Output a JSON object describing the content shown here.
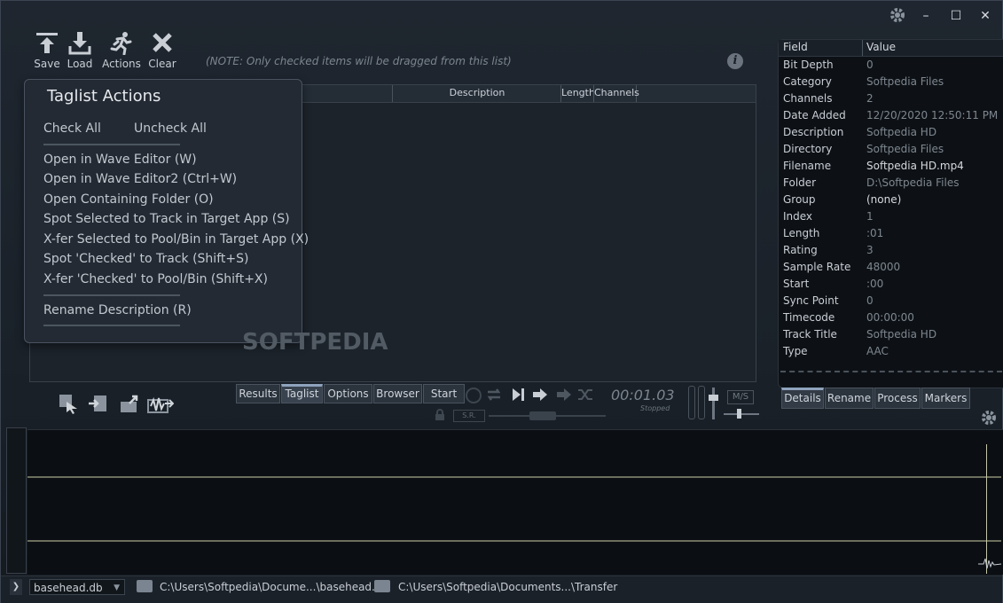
{
  "window": {
    "settings_icon": "gear-icon",
    "minimize": "–",
    "maximize": "☐",
    "close": "✕"
  },
  "toolbar": {
    "save": "Save",
    "load": "Load",
    "actions": "Actions",
    "clear": "Clear",
    "note": "(NOTE: Only checked items will be dragged from this list)"
  },
  "list": {
    "columns": [
      "Description",
      "Length",
      "Channels"
    ]
  },
  "menu": {
    "title": "Taglist Actions",
    "check_all": "Check All",
    "uncheck_all": "Uncheck All",
    "items": [
      "Open in Wave Editor (W)",
      "Open in Wave Editor2 (Ctrl+W)",
      "Open Containing Folder (O)",
      "Spot Selected to Track in Target App (S)",
      "X-fer Selected to Pool/Bin in Target App (X)",
      "Spot 'Checked' to Track (Shift+S)",
      "X-fer 'Checked' to Pool/Bin (Shift+X)"
    ],
    "rename": "Rename Description (R)"
  },
  "watermark": "SOFTPEDIA",
  "mode_tabs": [
    "Results",
    "Taglist",
    "Options",
    "Browser",
    "Start"
  ],
  "transport": {
    "time": "00:01.03",
    "state": "Stopped",
    "ms": "M/S",
    "sr": "S.R."
  },
  "details": {
    "header_field": "Field",
    "header_value": "Value",
    "rows": [
      {
        "field": "Bit Depth",
        "value": "0"
      },
      {
        "field": "Category",
        "value": "Softpedia Files"
      },
      {
        "field": "Channels",
        "value": "2"
      },
      {
        "field": "Date Added",
        "value": "12/20/2020 12:50:11 PM"
      },
      {
        "field": "Description",
        "value": "Softpedia HD"
      },
      {
        "field": "Directory",
        "value": "Softpedia Files"
      },
      {
        "field": "Filename",
        "value": "Softpedia HD.mp4"
      },
      {
        "field": "Folder",
        "value": "D:\\Softpedia Files"
      },
      {
        "field": "Group",
        "value": "(none)"
      },
      {
        "field": "Index",
        "value": "1"
      },
      {
        "field": "Length",
        "value": ":01"
      },
      {
        "field": "Rating",
        "value": "3"
      },
      {
        "field": "Sample Rate",
        "value": "48000"
      },
      {
        "field": "Start",
        "value": ":00"
      },
      {
        "field": "Sync Point",
        "value": "0"
      },
      {
        "field": "Timecode",
        "value": "00:00:00"
      },
      {
        "field": "Track Title",
        "value": "Softpedia HD"
      },
      {
        "field": "Type",
        "value": "AAC"
      }
    ]
  },
  "right_tabs": [
    "Details",
    "Rename",
    "Process",
    "Markers"
  ],
  "status": {
    "db": "basehead.db",
    "path1": "C:\\Users\\Softpedia\\Docume...\\basehead.db",
    "path2": "C:\\Users\\Softpedia\\Documents...\\Transfer"
  }
}
